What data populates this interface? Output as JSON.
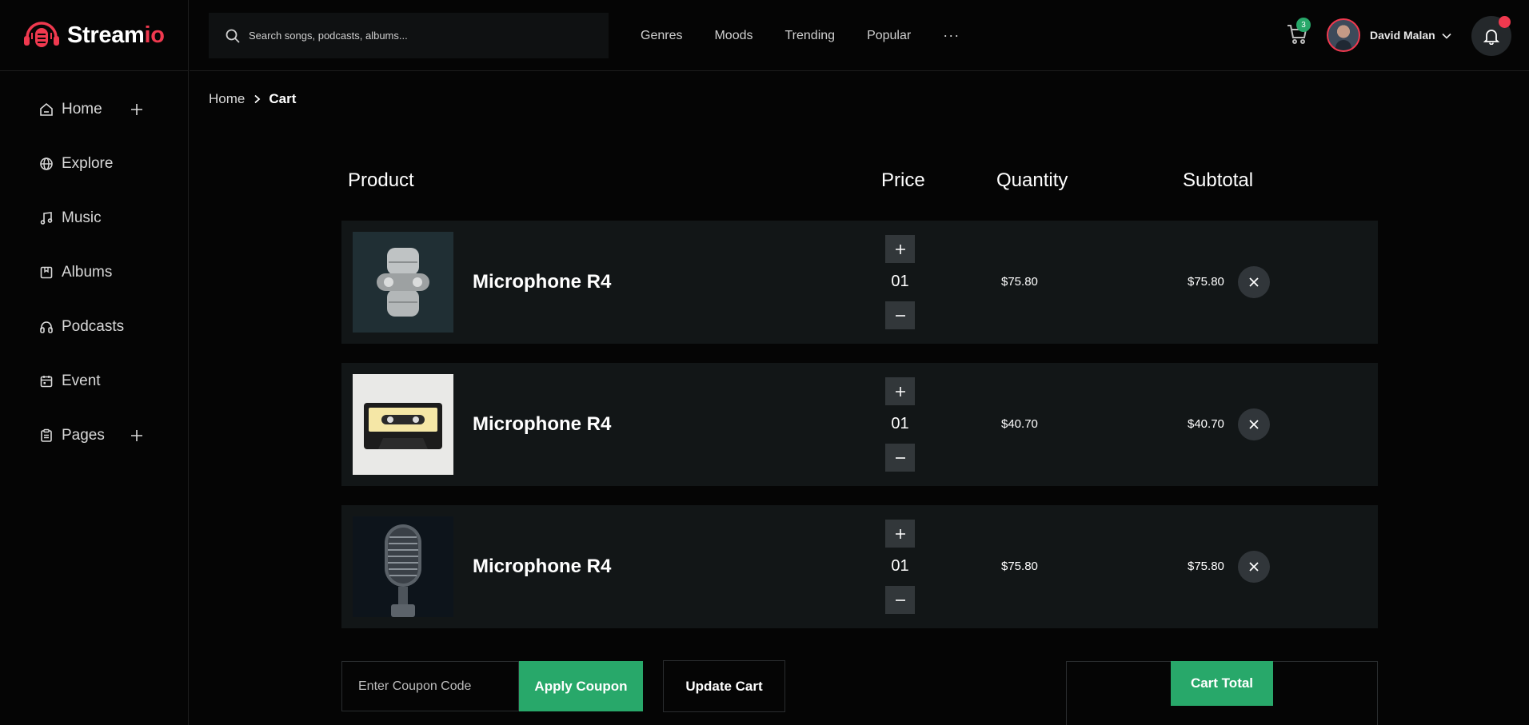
{
  "brand": {
    "name_part1": "Stream",
    "name_part2": "io",
    "logo_icon": "headphone-mic-icon",
    "accent_color": "#f0394f"
  },
  "sidebar": {
    "items": [
      {
        "label": "Home",
        "icon": "home-icon",
        "expandable": true
      },
      {
        "label": "Explore",
        "icon": "globe-icon",
        "expandable": false
      },
      {
        "label": "Music",
        "icon": "music-note-icon",
        "expandable": false
      },
      {
        "label": "Albums",
        "icon": "album-icon",
        "expandable": false
      },
      {
        "label": "Podcasts",
        "icon": "headphones-icon",
        "expandable": false
      },
      {
        "label": "Event",
        "icon": "calendar-icon",
        "expandable": false
      },
      {
        "label": "Pages",
        "icon": "clipboard-icon",
        "expandable": true
      }
    ]
  },
  "header": {
    "search_placeholder": "Search songs, podcasts, albums...",
    "nav": [
      "Genres",
      "Moods",
      "Trending",
      "Popular"
    ],
    "more_label": "···",
    "cart_count": "3",
    "user_name": "David Malan"
  },
  "breadcrumb": {
    "home": "Home",
    "current": "Cart"
  },
  "cart": {
    "headers": {
      "product": "Product",
      "price": "Price",
      "quantity": "Quantity",
      "subtotal": "Subtotal"
    },
    "rows": [
      {
        "name": "Microphone R4",
        "qty": "01",
        "price": "$75.80",
        "subtotal": "$75.80",
        "image": "earbuds-image"
      },
      {
        "name": "Microphone R4",
        "qty": "01",
        "price": "$40.70",
        "subtotal": "$40.70",
        "image": "cassette-image"
      },
      {
        "name": "Microphone R4",
        "qty": "01",
        "price": "$75.80",
        "subtotal": "$75.80",
        "image": "microphone-image"
      }
    ],
    "coupon_placeholder": "Enter Coupon Code",
    "apply_label": "Apply Coupon",
    "update_label": "Update Cart",
    "total_label": "Cart Total"
  },
  "colors": {
    "background": "#050505",
    "row_bg": "#121617",
    "green": "#28a86a",
    "red": "#f0394f"
  }
}
